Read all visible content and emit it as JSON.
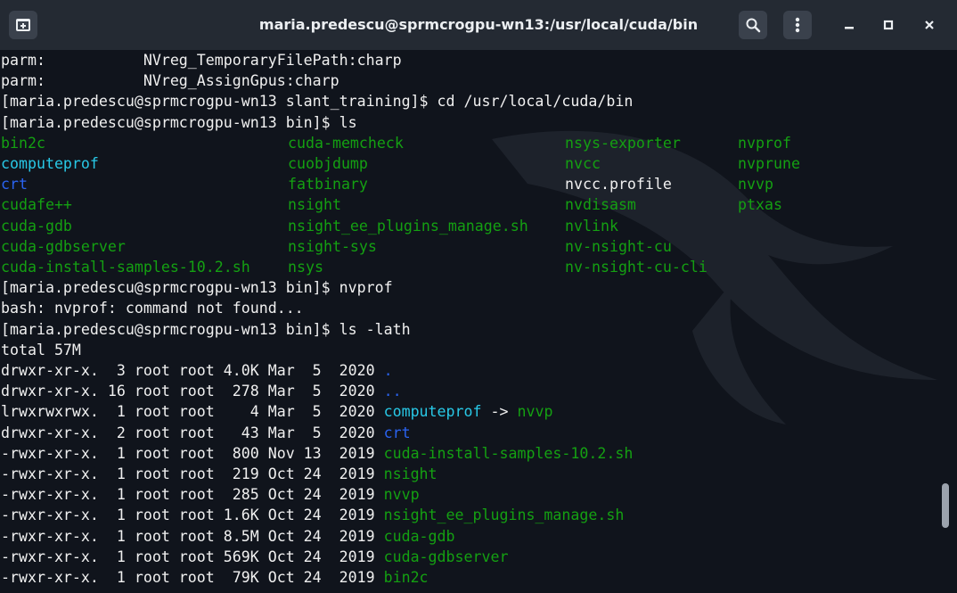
{
  "window": {
    "title": "maria.predescu@sprmcrogpu-wn13:/usr/local/cuda/bin"
  },
  "colors": {
    "titlebar_bg": "#242a33",
    "terminal_bg": "#10141c",
    "text_default": "#f0f0f0",
    "executable_green": "#14a012",
    "link_cyan": "#28c8e6",
    "directory_blue": "#2a63f0"
  },
  "terminal": {
    "lines": [
      "parm:           NVreg_TemporaryFilePath:charp",
      "parm:           NVreg_AssignGpus:charp",
      "[maria.predescu@sprmcrogpu-wn13 slant_training]$ cd /usr/local/cuda/bin",
      "[maria.predescu@sprmcrogpu-wn13 bin]$ ls",
      "",
      "",
      "",
      "",
      "",
      "",
      "",
      "[maria.predescu@sprmcrogpu-wn13 bin]$ nvprof",
      "bash: nvprof: command not found...",
      "[maria.predescu@sprmcrogpu-wn13 bin]$ ls -lath",
      "total 57M"
    ],
    "ls_grid": [
      [
        {
          "text": "bin2c",
          "color": "green"
        },
        {
          "text": "cuda-memcheck",
          "color": "green"
        },
        {
          "text": "nsys-exporter",
          "color": "green"
        },
        {
          "text": "nvprof",
          "color": "green"
        }
      ],
      [
        {
          "text": "computeprof",
          "color": "cyan"
        },
        {
          "text": "cuobjdump",
          "color": "green"
        },
        {
          "text": "nvcc",
          "color": "green"
        },
        {
          "text": "nvprune",
          "color": "green"
        }
      ],
      [
        {
          "text": "crt",
          "color": "blue"
        },
        {
          "text": "fatbinary",
          "color": "green"
        },
        {
          "text": "nvcc.profile",
          "color": "white"
        },
        {
          "text": "nvvp",
          "color": "green"
        }
      ],
      [
        {
          "text": "cudafe++",
          "color": "green"
        },
        {
          "text": "nsight",
          "color": "green"
        },
        {
          "text": "nvdisasm",
          "color": "green"
        },
        {
          "text": "ptxas",
          "color": "green"
        }
      ],
      [
        {
          "text": "cuda-gdb",
          "color": "green"
        },
        {
          "text": "nsight_ee_plugins_manage.sh",
          "color": "green"
        },
        {
          "text": "nvlink",
          "color": "green"
        },
        {
          "text": "",
          "color": "green"
        }
      ],
      [
        {
          "text": "cuda-gdbserver",
          "color": "green"
        },
        {
          "text": "nsight-sys",
          "color": "green"
        },
        {
          "text": "nv-nsight-cu",
          "color": "green"
        },
        {
          "text": "",
          "color": "green"
        }
      ],
      [
        {
          "text": "cuda-install-samples-10.2.sh",
          "color": "green"
        },
        {
          "text": "nsys",
          "color": "green"
        },
        {
          "text": "nv-nsight-cu-cli",
          "color": "green"
        },
        {
          "text": "",
          "color": "green"
        }
      ]
    ],
    "ls_long": [
      {
        "prefix": "drwxr-xr-x.  3 root root 4.0K Mar  5  2020 ",
        "name": ".",
        "color": "blue",
        "suffix": ""
      },
      {
        "prefix": "drwxr-xr-x. 16 root root  278 Mar  5  2020 ",
        "name": "..",
        "color": "blue",
        "suffix": ""
      },
      {
        "prefix": "lrwxrwxrwx.  1 root root    4 Mar  5  2020 ",
        "name": "computeprof",
        "color": "cyan",
        "suffix": " -> ",
        "target": "nvvp"
      },
      {
        "prefix": "drwxr-xr-x.  2 root root   43 Mar  5  2020 ",
        "name": "crt",
        "color": "blue",
        "suffix": ""
      },
      {
        "prefix": "-rwxr-xr-x.  1 root root  800 Nov 13  2019 ",
        "name": "cuda-install-samples-10.2.sh",
        "color": "green",
        "suffix": ""
      },
      {
        "prefix": "-rwxr-xr-x.  1 root root  219 Oct 24  2019 ",
        "name": "nsight",
        "color": "green",
        "suffix": ""
      },
      {
        "prefix": "-rwxr-xr-x.  1 root root  285 Oct 24  2019 ",
        "name": "nvvp",
        "color": "green",
        "suffix": ""
      },
      {
        "prefix": "-rwxr-xr-x.  1 root root 1.6K Oct 24  2019 ",
        "name": "nsight_ee_plugins_manage.sh",
        "color": "green",
        "suffix": ""
      },
      {
        "prefix": "-rwxr-xr-x.  1 root root 8.5M Oct 24  2019 ",
        "name": "cuda-gdb",
        "color": "green",
        "suffix": ""
      },
      {
        "prefix": "-rwxr-xr-x.  1 root root 569K Oct 24  2019 ",
        "name": "cuda-gdbserver",
        "color": "green",
        "suffix": ""
      },
      {
        "prefix": "-rwxr-xr-x.  1 root root  79K Oct 24  2019 ",
        "name": "bin2c",
        "color": "green",
        "suffix": ""
      }
    ]
  },
  "icons": {
    "new_tab": "terminal-plus-icon",
    "search": "search-icon",
    "menu": "kebab-menu-icon",
    "minimize": "minimize-icon",
    "maximize": "maximize-icon",
    "close": "close-icon"
  }
}
